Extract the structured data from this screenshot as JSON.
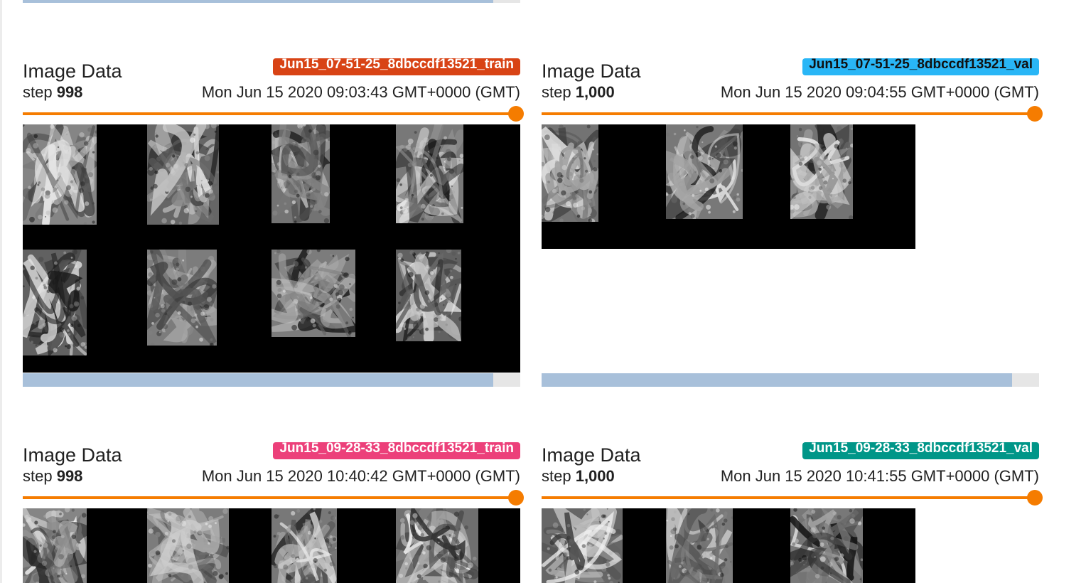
{
  "cards": [
    {
      "title": "Image Data",
      "run": "Jun15_07-51-25_8dbccdf13521_train",
      "run_color": "#d84315",
      "step_prefix": "step ",
      "step": "998",
      "wall_time": "Mon Jun 15 2020 09:03:43 GMT+0000 (GMT)",
      "slider_value": 1.0
    },
    {
      "title": "Image Data",
      "run": "Jun15_07-51-25_8dbccdf13521_val",
      "run_color": "#29b6f6",
      "step_prefix": "step ",
      "step": "1,000",
      "wall_time": "Mon Jun 15 2020 09:04:55 GMT+0000 (GMT)",
      "slider_value": 1.0
    },
    {
      "title": "Image Data",
      "run": "Jun15_09-28-33_8dbccdf13521_train",
      "run_color": "#ec407a",
      "step_prefix": "step ",
      "step": "998",
      "wall_time": "Mon Jun 15 2020 10:40:42 GMT+0000 (GMT)",
      "slider_value": 1.0
    },
    {
      "title": "Image Data",
      "run": "Jun15_09-28-33_8dbccdf13521_val",
      "run_color": "#009688",
      "step_prefix": "step ",
      "step": "1,000",
      "wall_time": "Mon Jun 15 2020 10:41:55 GMT+0000 (GMT)",
      "slider_value": 1.0
    }
  ],
  "scrollbars": {
    "thumb_fraction": 0.946,
    "thumb_color": "#a8c0da",
    "track_color": "#e6e6e6"
  },
  "icons": {
    "slider_handle": "circle-handle-icon"
  }
}
